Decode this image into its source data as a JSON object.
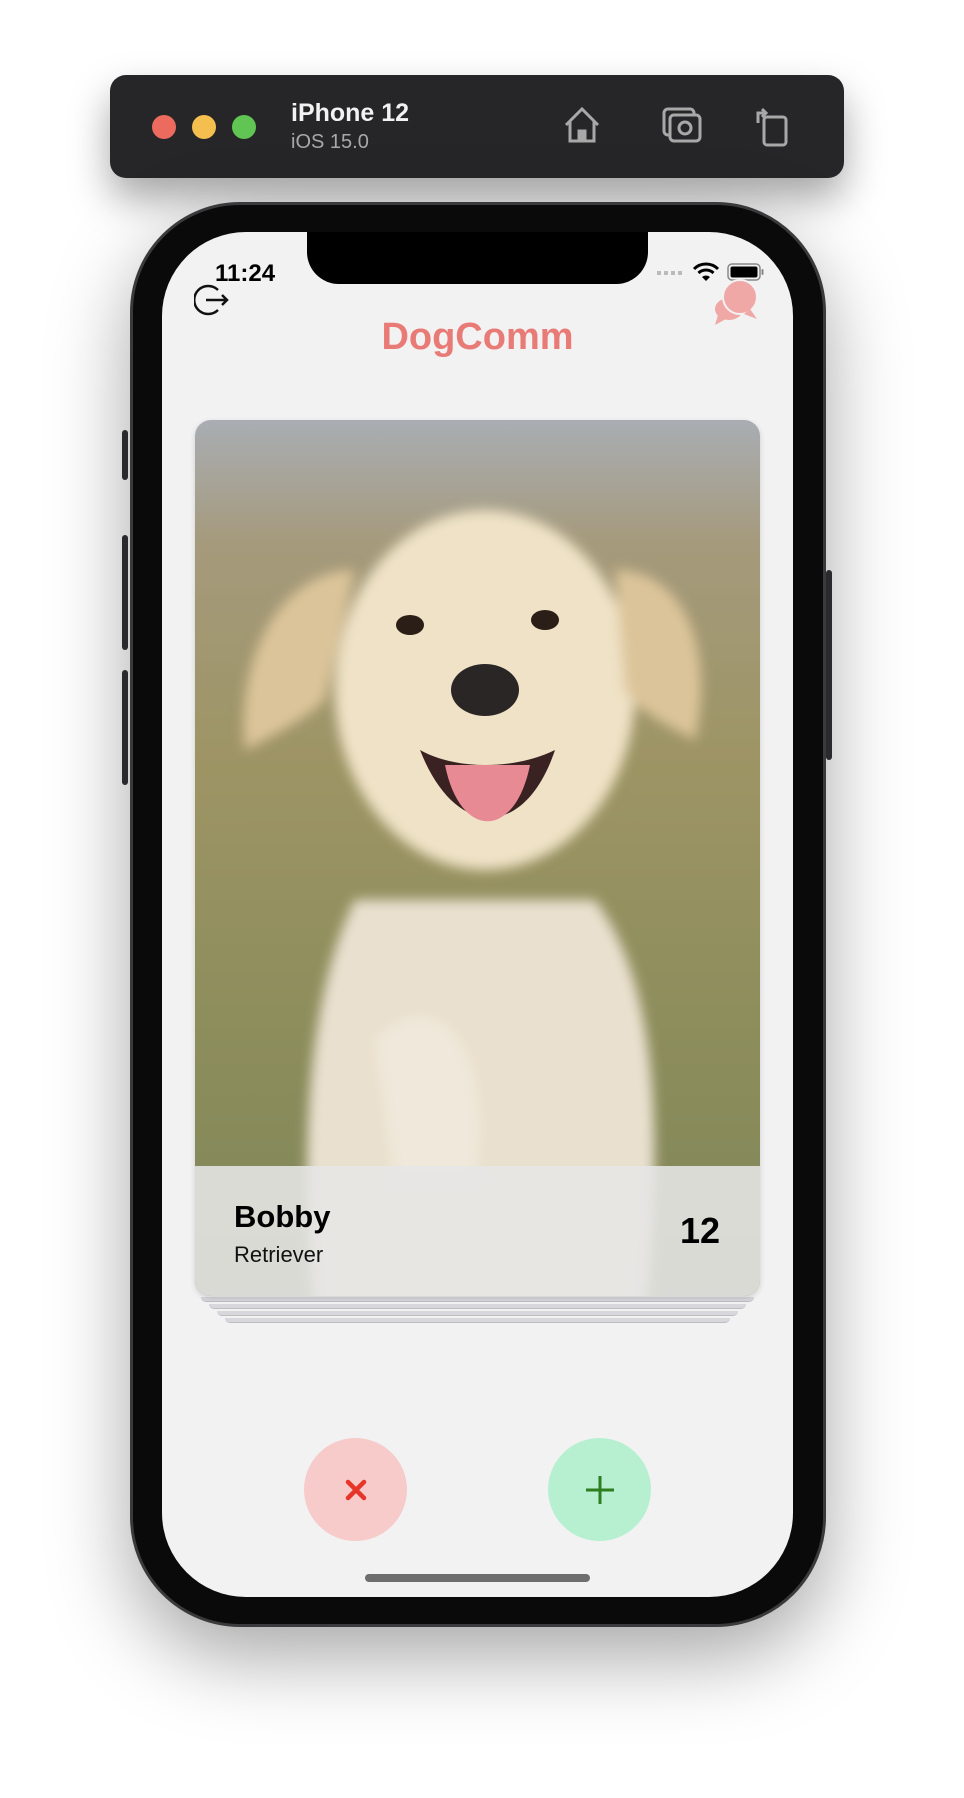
{
  "simulator": {
    "device_name": "iPhone 12",
    "os_version": "iOS 15.0",
    "window_controls": {
      "close": "#ed6a5e",
      "minimize": "#f5bf4f",
      "zoom": "#61c554"
    },
    "toolbar_icons": [
      "home-icon",
      "screenshot-icon",
      "rotate-icon"
    ]
  },
  "status_bar": {
    "time": "11:24",
    "icons": [
      "signal-icon",
      "wifi-icon",
      "battery-icon"
    ]
  },
  "header": {
    "title": "DogComm",
    "left_icon": "logout-icon",
    "right_icon": "chat-bubbles-icon",
    "accent": "#e97b77"
  },
  "card": {
    "name": "Bobby",
    "breed": "Retriever",
    "age": "12"
  },
  "actions": {
    "reject": {
      "icon": "x-icon",
      "bg": "#f6cbca",
      "color": "#e8352a"
    },
    "accept": {
      "icon": "plus-icon",
      "bg": "#b7f0d1",
      "color": "#2e7d1e"
    }
  }
}
